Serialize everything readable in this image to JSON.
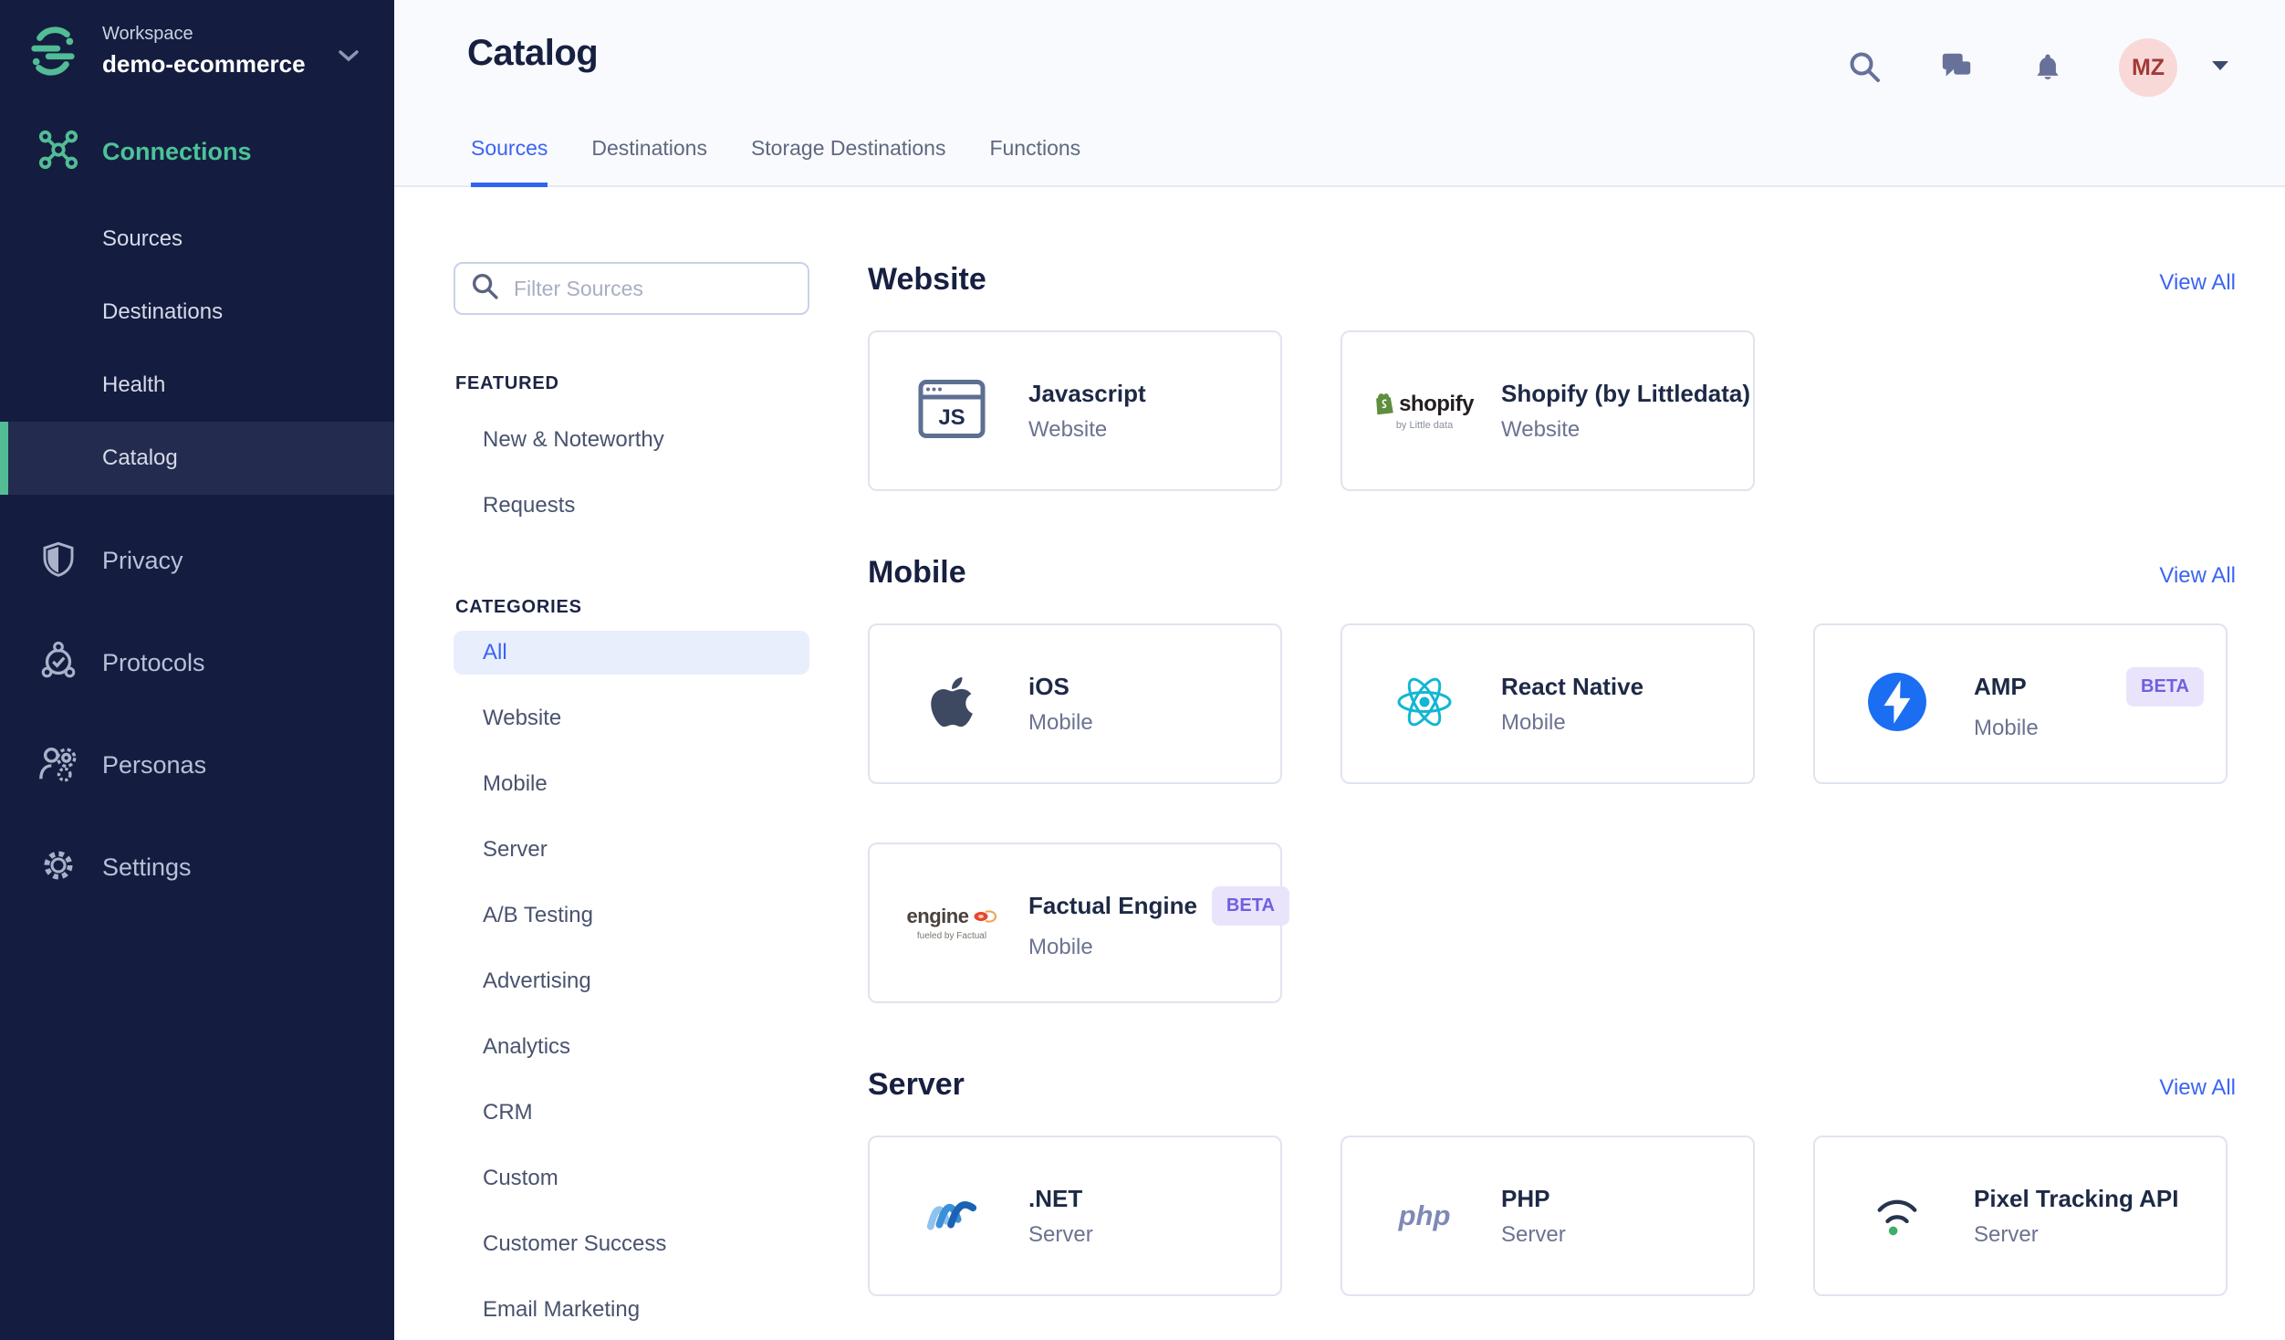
{
  "colors": {
    "sidebar_bg": "#141d40",
    "accent_green": "#52bd95",
    "accent_blue": "#3b63f3",
    "badge_bg": "#e9e4fb",
    "badge_text": "#6f5fe0",
    "header_bg": "#f9fafd",
    "active_row_bg": "#232c4f",
    "selected_pill_bg": "#e8eefc"
  },
  "sidebar": {
    "workspace_label": "Workspace",
    "workspace_name": "demo-ecommerce",
    "nav": [
      {
        "label": "Connections",
        "icon": "connections-icon",
        "type": "section",
        "active": true
      },
      {
        "label": "Sources",
        "type": "sub"
      },
      {
        "label": "Destinations",
        "type": "sub"
      },
      {
        "label": "Health",
        "type": "sub"
      },
      {
        "label": "Catalog",
        "type": "sub",
        "active": true
      },
      {
        "label": "Privacy",
        "icon": "privacy-shield-icon",
        "type": "section"
      },
      {
        "label": "Protocols",
        "icon": "protocols-icon",
        "type": "section"
      },
      {
        "label": "Personas",
        "icon": "personas-icon",
        "type": "section"
      },
      {
        "label": "Settings",
        "icon": "settings-gear-icon",
        "type": "section"
      }
    ]
  },
  "header": {
    "title": "Catalog",
    "tabs": [
      {
        "label": "Sources",
        "active": true
      },
      {
        "label": "Destinations",
        "active": false
      },
      {
        "label": "Storage Destinations",
        "active": false
      },
      {
        "label": "Functions",
        "active": false
      }
    ]
  },
  "topbar": {
    "icons": [
      "search-icon",
      "chat-icon",
      "bell-icon"
    ],
    "avatar_initials": "MZ"
  },
  "filter": {
    "placeholder": "Filter Sources",
    "featured_heading": "FEATURED",
    "featured": [
      "New & Noteworthy",
      "Requests"
    ],
    "categories_heading": "CATEGORIES",
    "selected_category": "All",
    "categories": [
      "All",
      "Website",
      "Mobile",
      "Server",
      "A/B Testing",
      "Advertising",
      "Analytics",
      "CRM",
      "Custom",
      "Customer Success",
      "Email Marketing"
    ]
  },
  "sections": [
    {
      "title": "Website",
      "view_all": "View All",
      "cards": [
        {
          "name": "Javascript",
          "category": "Website",
          "icon": "javascript-icon"
        },
        {
          "name": "Shopify (by Littledata)",
          "category": "Website",
          "icon": "shopify-icon"
        }
      ]
    },
    {
      "title": "Mobile",
      "view_all": "View All",
      "cards": [
        {
          "name": "iOS",
          "category": "Mobile",
          "icon": "apple-icon"
        },
        {
          "name": "React Native",
          "category": "Mobile",
          "icon": "react-icon"
        },
        {
          "name": "AMP",
          "category": "Mobile",
          "icon": "amp-icon",
          "badge": "BETA",
          "badge_align": "right"
        },
        {
          "name": "Factual Engine",
          "category": "Mobile",
          "icon": "factual-engine-icon",
          "badge": "BETA"
        }
      ]
    },
    {
      "title": "Server",
      "view_all": "View All",
      "cards": [
        {
          "name": ".NET",
          "category": "Server",
          "icon": "dotnet-icon"
        },
        {
          "name": "PHP",
          "category": "Server",
          "icon": "php-icon"
        },
        {
          "name": "Pixel Tracking API",
          "category": "Server",
          "icon": "pixel-tracking-icon"
        }
      ]
    }
  ]
}
